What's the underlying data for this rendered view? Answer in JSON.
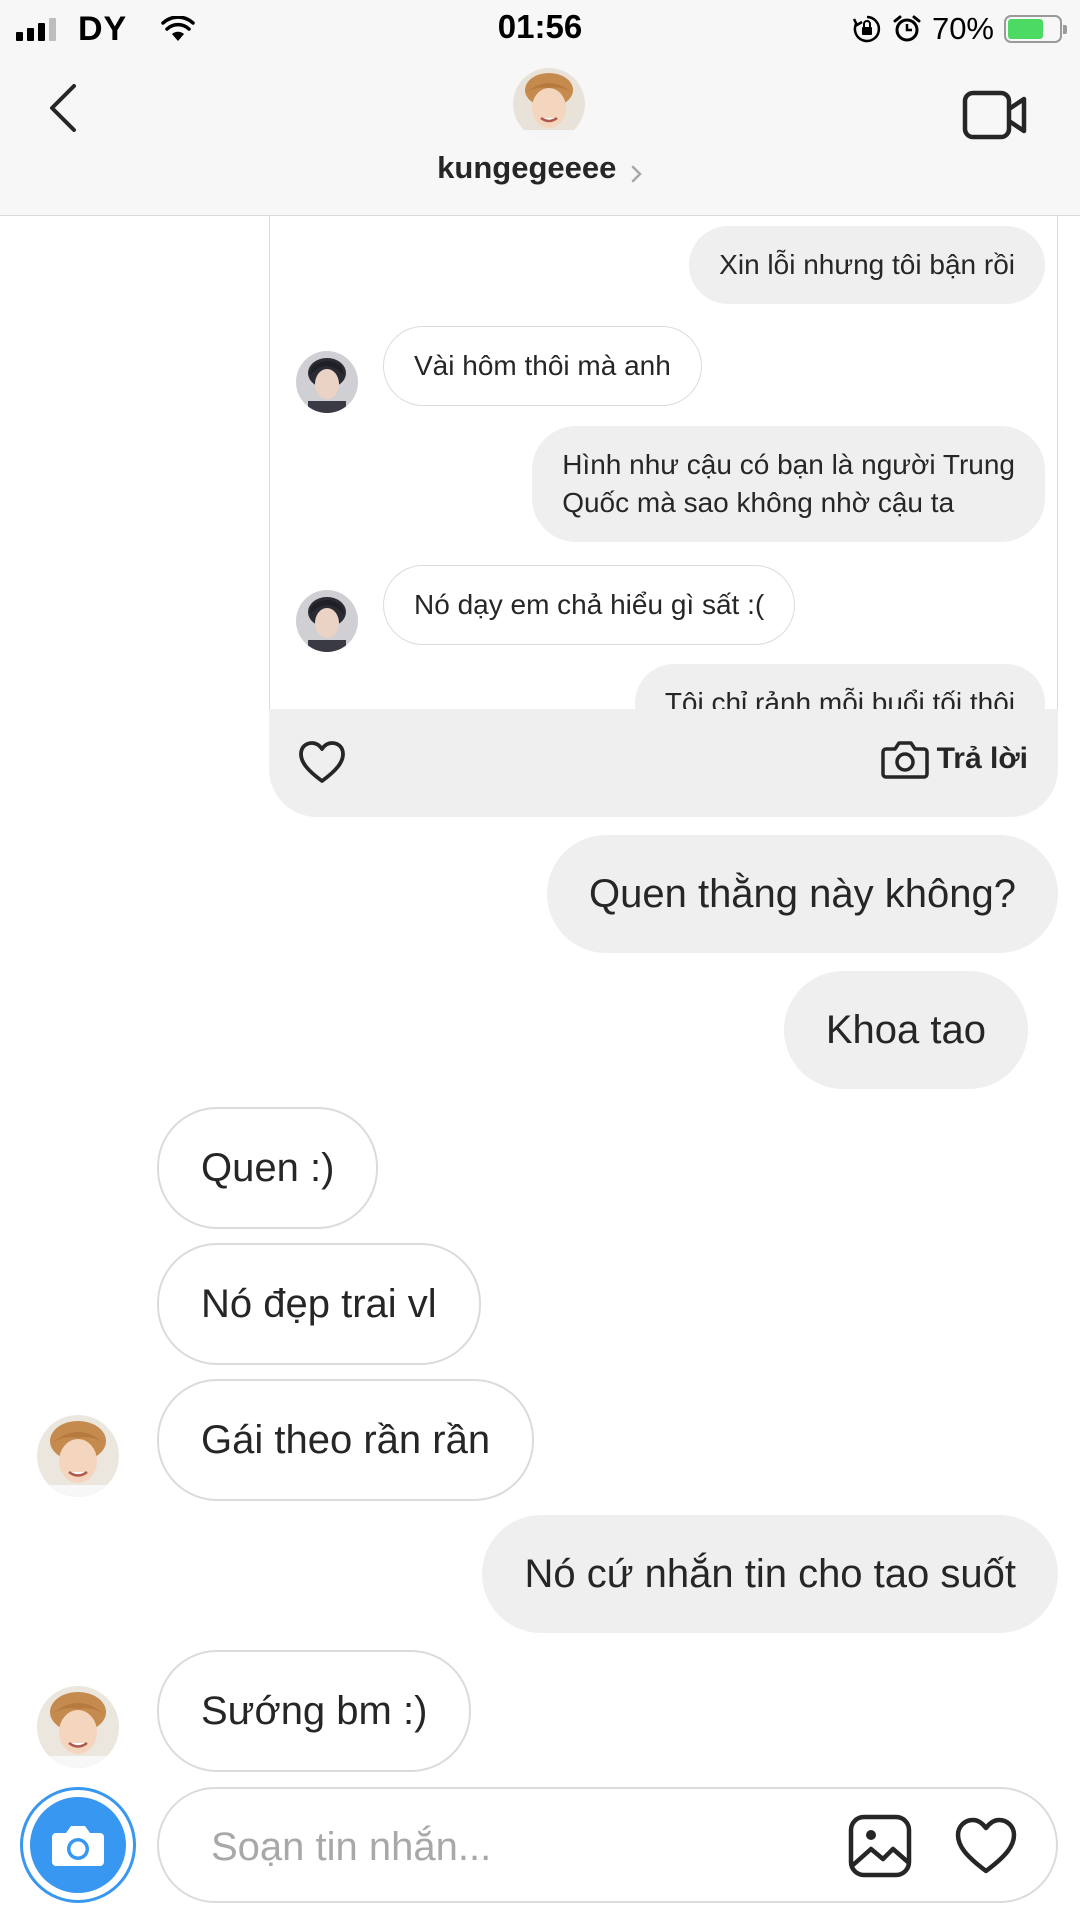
{
  "status_bar": {
    "carrier": "DY",
    "time": "01:56",
    "battery_percent": "70%",
    "battery_level": 0.7,
    "signal_bars": 3,
    "icons": [
      "signal-icon",
      "wifi-icon",
      "rotation-lock-icon",
      "alarm-icon",
      "battery-icon"
    ]
  },
  "header": {
    "username": "kungegeeee",
    "icons": [
      "back-arrow-icon",
      "chevron-right-icon",
      "video-camera-icon"
    ]
  },
  "reply_card": {
    "messages": [
      {
        "side": "out",
        "text": "Xin lỗi nhưng tôi bận rồi"
      },
      {
        "side": "in",
        "text": "Vài hôm thôi mà anh"
      },
      {
        "side": "out",
        "lines": [
          "Hình như cậu có bạn là người Trung",
          "Quốc mà sao không nhờ cậu ta"
        ]
      },
      {
        "side": "in",
        "text": "Nó dạy em chả hiểu gì sất :("
      },
      {
        "side": "out",
        "text": "Tôi chỉ rảnh mỗi buổi tối thôi"
      }
    ],
    "reply_label": "Trả lời",
    "icons": [
      "heart-icon",
      "camera-icon"
    ]
  },
  "messages": [
    {
      "side": "out",
      "text": "Quen thằng này không?"
    },
    {
      "side": "out",
      "text": "Khoa tao"
    },
    {
      "side": "in",
      "text": "Quen :)"
    },
    {
      "side": "in",
      "text": "Nó đẹp trai vl"
    },
    {
      "side": "in",
      "text": "Gái theo rần rần"
    },
    {
      "side": "out",
      "text": "Nó cứ nhắn tin cho tao suốt"
    },
    {
      "side": "in",
      "text": "Sướng bm :)"
    }
  ],
  "composer": {
    "placeholder": "Soạn tin nhắn...",
    "value": "",
    "icons": [
      "camera-icon",
      "gallery-icon",
      "heart-icon"
    ]
  },
  "colors": {
    "accent": "#3897f0",
    "battery": "#4cd964",
    "bubble_out": "#efefef",
    "border": "#dbdbdb",
    "header_bg": "#f7f7f7"
  }
}
